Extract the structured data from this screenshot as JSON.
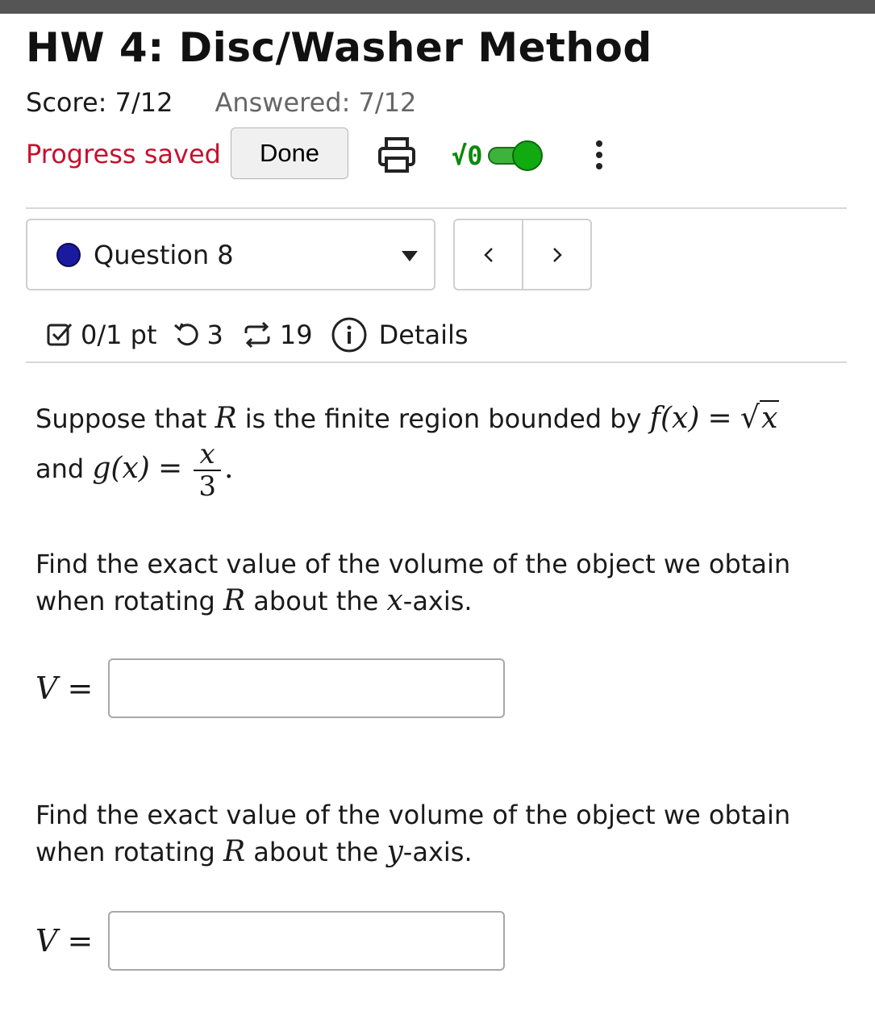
{
  "assignment": {
    "title": "HW 4: Disc/Washer Method",
    "score_text": "Score: 7/12",
    "answered_text": "Answered: 7/12",
    "progress_status": "Progress saved",
    "done_label": "Done",
    "math_toggle_label": "√0",
    "math_toggle_on": true
  },
  "colors": {
    "progress_saved": "#c8102e",
    "toggle_on": "#11aa11",
    "question_status_dot": "#1a1aa0"
  },
  "icons": [
    "print-icon",
    "sqrt-icon",
    "toggle-switch",
    "more-vertical-icon",
    "chevron-left-icon",
    "chevron-right-icon",
    "checkbox-icon",
    "undo-icon",
    "retry-icon",
    "info-icon",
    "caret-down-icon"
  ],
  "question_nav": {
    "label": "Question 8",
    "prev": "<",
    "next": ">"
  },
  "question_meta": {
    "points": "0/1 pt",
    "attempts": "3",
    "submissions": "19",
    "details_label": "Details"
  },
  "problem": {
    "intro_1": "Suppose that",
    "R": "R",
    "intro_2": "is the finite region bounded by",
    "f_lhs": "f(x)",
    "eq": "=",
    "sqrt_sym": "√",
    "sqrt_arg": "x",
    "and": "and",
    "g_lhs": "g(x)",
    "g_num": "x",
    "g_den": "3",
    "period": ".",
    "part1_line1": "Find the exact value of the volume of the object we obtain",
    "part1_pre": "when rotating",
    "part1_mid": "about the",
    "part1_axis": "x",
    "part1_post": "-axis.",
    "part2_line1": "Find the exact value of the volume of the object we obtain",
    "part2_pre": "when rotating",
    "part2_mid": "about the",
    "part2_axis": "y",
    "part2_post": "-axis.",
    "answer_var": "V",
    "answer_eq": "=",
    "answer1_value": "",
    "answer2_value": ""
  }
}
